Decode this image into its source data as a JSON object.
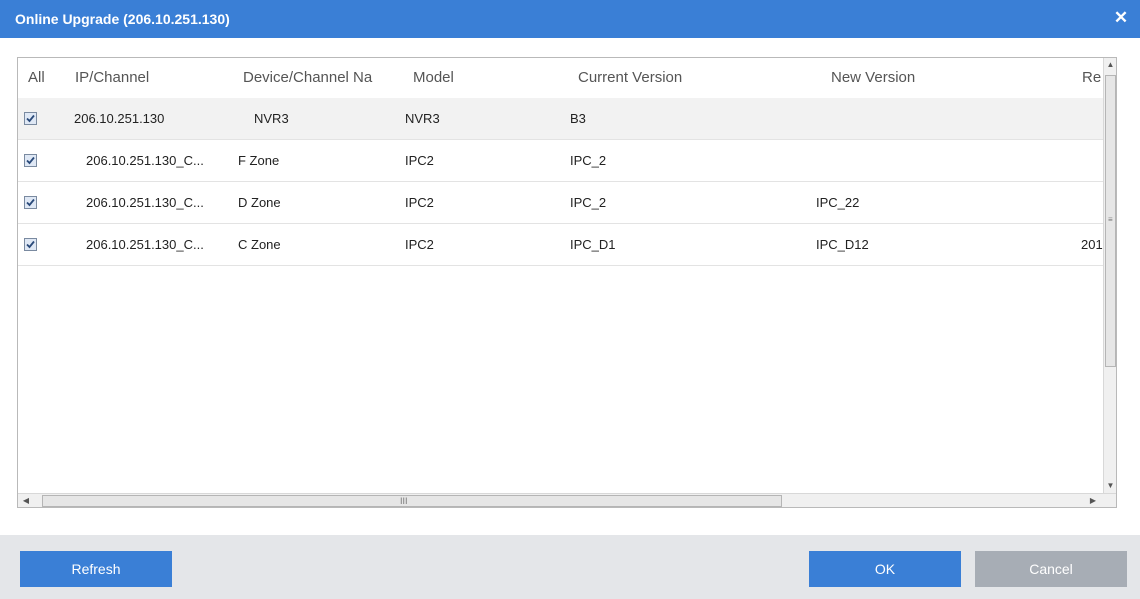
{
  "window": {
    "title": "Online Upgrade (206.10.251.130)",
    "close_glyph": "✕"
  },
  "table": {
    "headers": [
      "All",
      "IP/Channel",
      "Device/Channel Na",
      "Model",
      "Current Version",
      "New Version",
      "Re"
    ],
    "rows": [
      {
        "checked": true,
        "ip": "206.10.251.130",
        "name": "NVR3",
        "model": "NVR3",
        "current": "B3",
        "new": "",
        "re": ""
      },
      {
        "checked": true,
        "ip": "206.10.251.130_C...",
        "name": "F Zone",
        "model": "IPC2",
        "current": "IPC_2",
        "new": "",
        "re": ""
      },
      {
        "checked": true,
        "ip": "206.10.251.130_C...",
        "name": "D Zone",
        "model": "IPC2",
        "current": "IPC_2",
        "new": "IPC_22",
        "re": ""
      },
      {
        "checked": true,
        "ip": "206.10.251.130_C...",
        "name": "C Zone",
        "model": "IPC2",
        "current": "IPC_D1",
        "new": "IPC_D12",
        "re": "201"
      }
    ]
  },
  "scrollbars": {
    "up_glyph": "▲",
    "down_glyph": "▼",
    "left_glyph": "◀",
    "right_glyph": "▶",
    "v_grip": "≡",
    "h_grip": "III"
  },
  "footer": {
    "refresh_label": "Refresh",
    "ok_label": "OK",
    "cancel_label": "Cancel"
  },
  "colors": {
    "accent": "#3a7fd6",
    "cancel": "#a7adb5",
    "footer_bg": "#e4e6e9"
  }
}
